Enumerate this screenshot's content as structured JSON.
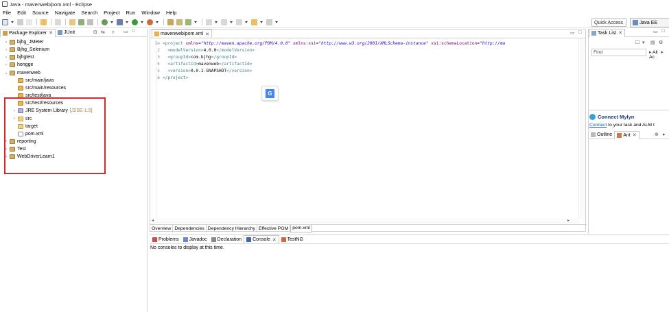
{
  "window": {
    "title": "Java - mavenweb/pom.xml - Eclipse"
  },
  "menu": [
    "File",
    "Edit",
    "Source",
    "Navigate",
    "Search",
    "Project",
    "Run",
    "Window",
    "Help"
  ],
  "toolbar": {
    "quick_access": "Quick Access",
    "perspective": "Java EE"
  },
  "package_explorer": {
    "tabs": [
      {
        "label": "Package Explorer"
      },
      {
        "label": "JUnit"
      }
    ],
    "tree": [
      {
        "label": "bjhg_JMeter",
        "decor": "",
        "indent": 0,
        "twisty": ">",
        "icon": "project"
      },
      {
        "label": "Bjhg_Selenium",
        "decor": "",
        "indent": 0,
        "twisty": ">",
        "icon": "project"
      },
      {
        "label": "bjhgtest",
        "decor": "",
        "indent": 0,
        "twisty": ">",
        "icon": "project"
      },
      {
        "label": "hongge",
        "decor": "",
        "indent": 0,
        "twisty": ">",
        "icon": "project"
      },
      {
        "label": "mavenweb",
        "decor": "",
        "indent": 0,
        "twisty": "v",
        "icon": "project"
      },
      {
        "label": "src/main/java",
        "decor": "",
        "indent": 1,
        "twisty": "",
        "icon": "pkgfolder"
      },
      {
        "label": "src/main/resources",
        "decor": "",
        "indent": 1,
        "twisty": "",
        "icon": "pkgfolder"
      },
      {
        "label": "src/test/java",
        "decor": "",
        "indent": 1,
        "twisty": "",
        "icon": "pkgfolder"
      },
      {
        "label": "src/test/resources",
        "decor": "",
        "indent": 1,
        "twisty": "",
        "icon": "pkgfolder"
      },
      {
        "label": "JRE System Library",
        "decor": "[J2SE-1.5]",
        "indent": 1,
        "twisty": ">",
        "icon": "library"
      },
      {
        "label": "src",
        "decor": "",
        "indent": 1,
        "twisty": ">",
        "icon": "folder"
      },
      {
        "label": "target",
        "decor": "",
        "indent": 1,
        "twisty": "",
        "icon": "folder"
      },
      {
        "label": "pom.xml",
        "decor": "",
        "indent": 1,
        "twisty": "",
        "icon": "xml"
      },
      {
        "label": "reporting",
        "decor": "",
        "indent": 0,
        "twisty": ">",
        "icon": "project"
      },
      {
        "label": "Test",
        "decor": "",
        "indent": 0,
        "twisty": ">",
        "icon": "project"
      },
      {
        "label": "WebDriverLearn1",
        "decor": "",
        "indent": 0,
        "twisty": ">",
        "icon": "project"
      }
    ]
  },
  "editor": {
    "tab": "mavenweb/pom.xml",
    "lines": [
      {
        "num": "1⊖",
        "parts": [
          [
            "tag",
            "<project "
          ],
          [
            "attr",
            "xmlns"
          ],
          [
            "text",
            "="
          ],
          [
            "str",
            "\"http://maven.apache.org/POM/4.0.0\""
          ],
          [
            "text",
            " "
          ],
          [
            "attr",
            "xmlns:xsi"
          ],
          [
            "text",
            "="
          ],
          [
            "str",
            "\"http://www.w3.org/2001/XMLSchema-instance\""
          ],
          [
            "text",
            " "
          ],
          [
            "attr",
            "xsi:schemaLocation"
          ],
          [
            "text",
            "="
          ],
          [
            "str",
            "\"http://ma"
          ]
        ]
      },
      {
        "num": "2",
        "parts": [
          [
            "text",
            "  "
          ],
          [
            "tag",
            "<modelVersion>"
          ],
          [
            "text",
            "4.0.0"
          ],
          [
            "tag",
            "</modelVersion>"
          ]
        ]
      },
      {
        "num": "3",
        "parts": [
          [
            "text",
            "  "
          ],
          [
            "tag",
            "<groupId>"
          ],
          [
            "text",
            "com.bjhg"
          ],
          [
            "tag",
            "</groupId>"
          ]
        ]
      },
      {
        "num": "4",
        "parts": [
          [
            "text",
            "  "
          ],
          [
            "tag",
            "<artifactId>"
          ],
          [
            "text",
            "mavenweb"
          ],
          [
            "tag",
            "</artifactId>"
          ]
        ]
      },
      {
        "num": "5",
        "parts": [
          [
            "text",
            "  "
          ],
          [
            "tag",
            "<version>"
          ],
          [
            "text",
            "0.0.1-SNAPSHOT"
          ],
          [
            "tag",
            "</version>"
          ]
        ]
      },
      {
        "num": "6",
        "parts": [
          [
            "tag",
            "</project>"
          ]
        ]
      }
    ],
    "bottom_tabs": [
      "Overview",
      "Dependencies",
      "Dependency Hierarchy",
      "Effective POM",
      "pom.xml"
    ]
  },
  "console": {
    "tabs": [
      "Problems",
      "Javadoc",
      "Declaration",
      "Console",
      "TestNG"
    ],
    "message": "No consoles to display at this time."
  },
  "task_list": {
    "tab": "Task List",
    "find_placeholder": "Find",
    "filter": "All",
    "filter2": "Ac"
  },
  "mylyn": {
    "title": "Connect Mylyn",
    "link": "Connect",
    "info": " to your task and ALM t"
  },
  "outline": {
    "tabs": [
      "Outline",
      "Ant"
    ]
  },
  "translate": {
    "letter": "G"
  }
}
